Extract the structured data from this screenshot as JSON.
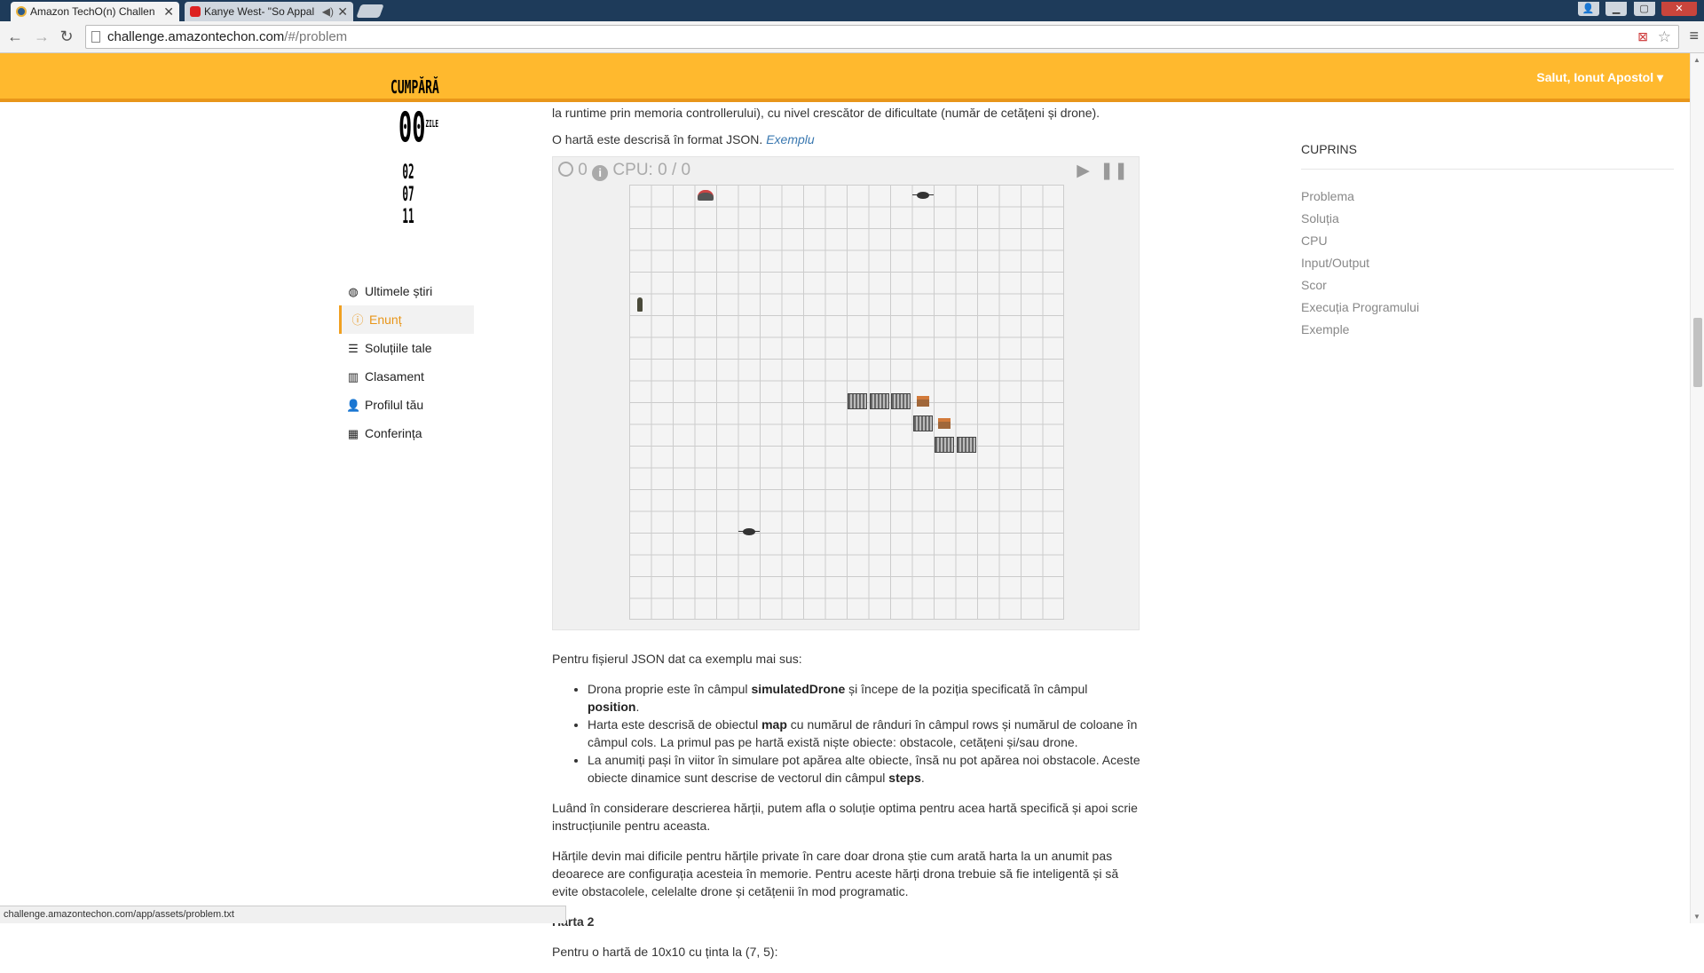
{
  "browser": {
    "tabs": [
      {
        "title": "Amazon TechO(n) Challen",
        "active": true
      },
      {
        "title": "Kanye West- \"So Appal",
        "active": false
      }
    ],
    "url_host": "challenge.amazontechon.com",
    "url_path": "/#/problem",
    "status_url": "challenge.amazontechon.com/app/assets/problem.txt"
  },
  "header": {
    "greeting": "Salut, Ionut Apostol",
    "greeting_caret": "▾",
    "logo_top": "CUMPĂRĂ",
    "logo_mid": "00",
    "logo_mid_sup": "ZILE",
    "logo_bottom": "02 07 11"
  },
  "sidebar": {
    "items": [
      {
        "label": "Ultimele știri",
        "icon": "globe-icon",
        "active": false
      },
      {
        "label": "Enunț",
        "icon": "info-icon",
        "active": true
      },
      {
        "label": "Soluțiile tale",
        "icon": "list-icon",
        "active": false
      },
      {
        "label": "Clasament",
        "icon": "bar-chart-icon",
        "active": false
      },
      {
        "label": "Profilul tău",
        "icon": "user-icon",
        "active": false
      },
      {
        "label": "Conferința",
        "icon": "calendar-icon",
        "active": false
      }
    ]
  },
  "main": {
    "intro_line": "la runtime prin memoria controllerului), cu nivel crescător de dificultate (număr de cetățeni și drone).",
    "map_desc": "O hartă este descrisă în format JSON.",
    "example_link": "Exemplu",
    "simulator": {
      "step": "0",
      "cpu_label": "CPU: 0 / 0",
      "play_icon": "play-icon",
      "pause_icon": "pause-icon",
      "grid_rows": 20,
      "grid_cols": 20
    },
    "after_sim": "Pentru fișierul JSON dat ca exemplu mai sus:",
    "bullets": [
      {
        "pre": "Drona proprie este în câmpul ",
        "b1": "simulatedDrone",
        "mid": " și începe de la poziția specificată în câmpul ",
        "b2": "position",
        "post": "."
      },
      {
        "pre": "Harta este descrisă de obiectul ",
        "b1": "map",
        "mid": " cu numărul de rânduri în câmpul rows și numărul de coloane în câmpul cols. La primul pas pe hartă există niște obiecte: obstacole, cetățeni și/sau drone.",
        "b2": "",
        "post": ""
      },
      {
        "pre": "La anumiți pași în viitor în simulare pot apărea alte obiecte, însă nu pot apărea noi obstacole. Aceste obiecte dinamice sunt descrise de vectorul din câmpul ",
        "b1": "steps",
        "mid": "",
        "b2": "",
        "post": "."
      }
    ],
    "para1": "Luând în considerare descrierea hărții, putem afla o soluție optima pentru acea hartă specifică și apoi scrie instrucțiunile pentru aceasta.",
    "para2": "Hărțile devin mai dificile pentru hărțile private în care doar drona știe cum arată harta la un anumit pas deoarece are configurația acesteia în memorie. Pentru aceste hărți drona trebuie să fie inteligentă și să evite obstacolele, celelalte drone și cetățenii în mod programatic.",
    "h_map2": "Harta 2",
    "map2_line": "Pentru o hartă de 10x10 cu ținta la (7, 5):"
  },
  "toc": {
    "heading": "CUPRINS",
    "items": [
      "Problema",
      "Soluția",
      "CPU",
      "Input/Output",
      "Scor",
      "Execuția Programului",
      "Exemple"
    ]
  }
}
